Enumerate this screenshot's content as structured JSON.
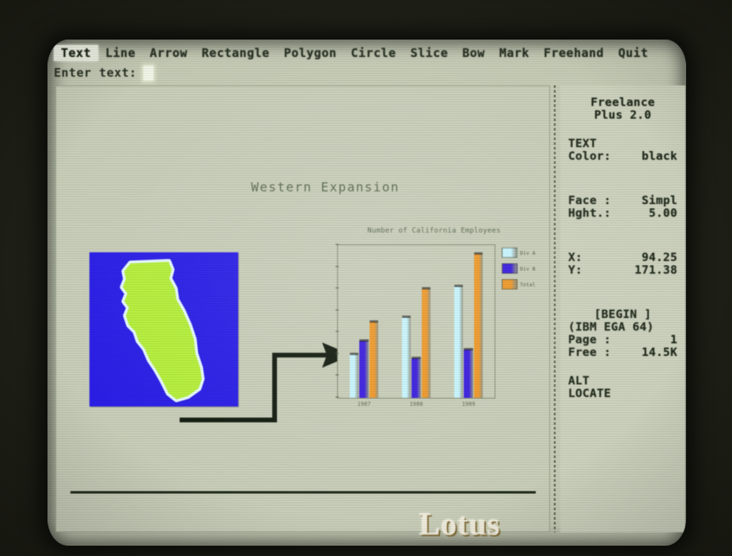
{
  "app": {
    "name": "Freelance",
    "version_line": "Plus 2.0"
  },
  "menubar": {
    "items": [
      {
        "label": "Text",
        "selected": true
      },
      {
        "label": "Line",
        "selected": false
      },
      {
        "label": "Arrow",
        "selected": false
      },
      {
        "label": "Rectangle",
        "selected": false
      },
      {
        "label": "Polygon",
        "selected": false
      },
      {
        "label": "Circle",
        "selected": false
      },
      {
        "label": "Slice",
        "selected": false
      },
      {
        "label": "Bow",
        "selected": false
      },
      {
        "label": "Mark",
        "selected": false
      },
      {
        "label": "Freehand",
        "selected": false
      },
      {
        "label": "Quit",
        "selected": false
      }
    ]
  },
  "prompt": {
    "label": "Enter text:",
    "value": "",
    "caret": "block-cursor"
  },
  "status": {
    "mode_heading": "TEXT",
    "color_label": "Color:",
    "color_value": "black",
    "face_label": "Face :",
    "face_value": "Simpl",
    "height_label": "Hght.:",
    "height_value": "5.00",
    "x_label": "X:",
    "x_value": "94.25",
    "y_label": "Y:",
    "y_value": "171.38",
    "begin_marker": "[BEGIN  ]",
    "device": "(IBM EGA 64)",
    "page_label": "Page :",
    "page_value": "1",
    "free_label": "Free :",
    "free_value": "14.5K",
    "key_alt": "ALT",
    "key_locate": "LOCATE"
  },
  "slide": {
    "title": "Western Expansion",
    "map_caption": "california-map",
    "logo": "Lotus",
    "map_colors": {
      "background": "#2b1fe8",
      "state": "#b6f03c",
      "outline": "#e8fbff"
    },
    "arrow_color": "#141c10",
    "rule_color": "#1d2618"
  },
  "chart_data": {
    "type": "bar",
    "title": "Number of California Employees",
    "xlabel": "",
    "ylabel": "",
    "categories": [
      "1987",
      "1988",
      "1989"
    ],
    "series": [
      {
        "name": "Div A",
        "color": "#c9f7ff",
        "values": [
          20,
          37,
          51
        ]
      },
      {
        "name": "Div B",
        "color": "#3a1fe0",
        "values": [
          26,
          18,
          22
        ]
      },
      {
        "name": "Total",
        "color": "#f09a2a",
        "values": [
          35,
          50,
          66
        ]
      }
    ],
    "ylim": [
      0,
      70
    ],
    "yticks": [
      0,
      10,
      20,
      30,
      40,
      50,
      60,
      70
    ],
    "grid": false,
    "legend_position": "right"
  }
}
